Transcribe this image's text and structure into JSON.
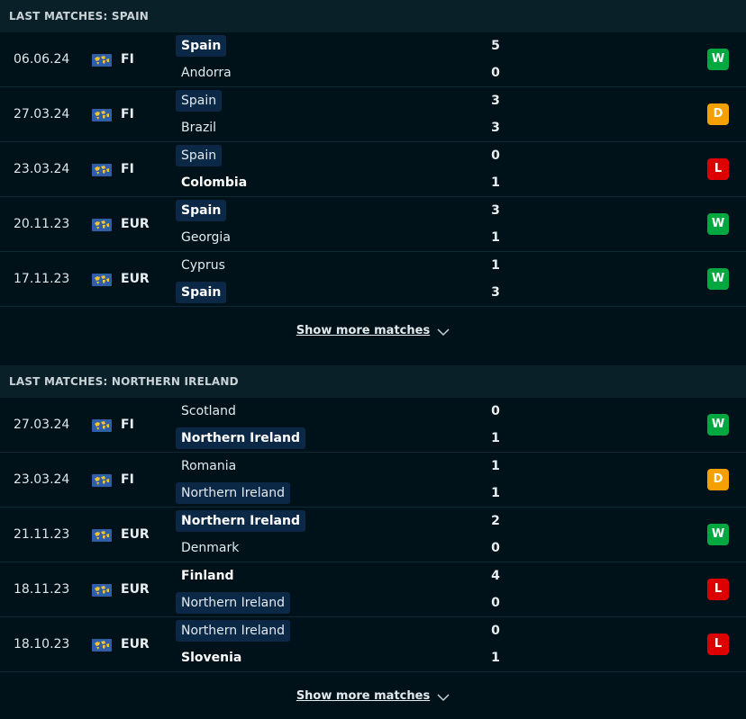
{
  "sections": [
    {
      "title": "LAST MATCHES: SPAIN",
      "show_more": "Show more matches",
      "matches": [
        {
          "date": "06.06.24",
          "competition": "FI",
          "home": "Spain",
          "away": "Andorra",
          "home_score": "5",
          "away_score": "0",
          "highlight": "home",
          "winner": "home",
          "result": "W"
        },
        {
          "date": "27.03.24",
          "competition": "FI",
          "home": "Spain",
          "away": "Brazil",
          "home_score": "3",
          "away_score": "3",
          "highlight": "home",
          "winner": "none",
          "result": "D"
        },
        {
          "date": "23.03.24",
          "competition": "FI",
          "home": "Spain",
          "away": "Colombia",
          "home_score": "0",
          "away_score": "1",
          "highlight": "home",
          "winner": "away",
          "result": "L"
        },
        {
          "date": "20.11.23",
          "competition": "EUR",
          "home": "Spain",
          "away": "Georgia",
          "home_score": "3",
          "away_score": "1",
          "highlight": "home",
          "winner": "home",
          "result": "W"
        },
        {
          "date": "17.11.23",
          "competition": "EUR",
          "home": "Cyprus",
          "away": "Spain",
          "home_score": "1",
          "away_score": "3",
          "highlight": "away",
          "winner": "away",
          "result": "W"
        }
      ]
    },
    {
      "title": "LAST MATCHES: NORTHERN IRELAND",
      "show_more": "Show more matches",
      "matches": [
        {
          "date": "27.03.24",
          "competition": "FI",
          "home": "Scotland",
          "away": "Northern Ireland",
          "home_score": "0",
          "away_score": "1",
          "highlight": "away",
          "winner": "away",
          "result": "W"
        },
        {
          "date": "23.03.24",
          "competition": "FI",
          "home": "Romania",
          "away": "Northern Ireland",
          "home_score": "1",
          "away_score": "1",
          "highlight": "away",
          "winner": "none",
          "result": "D"
        },
        {
          "date": "21.11.23",
          "competition": "EUR",
          "home": "Northern Ireland",
          "away": "Denmark",
          "home_score": "2",
          "away_score": "0",
          "highlight": "home",
          "winner": "home",
          "result": "W"
        },
        {
          "date": "18.11.23",
          "competition": "EUR",
          "home": "Finland",
          "away": "Northern Ireland",
          "home_score": "4",
          "away_score": "0",
          "highlight": "away",
          "winner": "home",
          "result": "L"
        },
        {
          "date": "18.10.23",
          "competition": "EUR",
          "home": "Northern Ireland",
          "away": "Slovenia",
          "home_score": "0",
          "away_score": "1",
          "highlight": "home",
          "winner": "away",
          "result": "L"
        }
      ]
    }
  ],
  "icons": {
    "competition": "world-map-icon",
    "show_more": "chevron-down-icon"
  },
  "colors": {
    "win": "#00a83f",
    "draw": "#f3a000",
    "loss": "#dc0000",
    "highlight": "#0b2847",
    "background": "#001219"
  }
}
